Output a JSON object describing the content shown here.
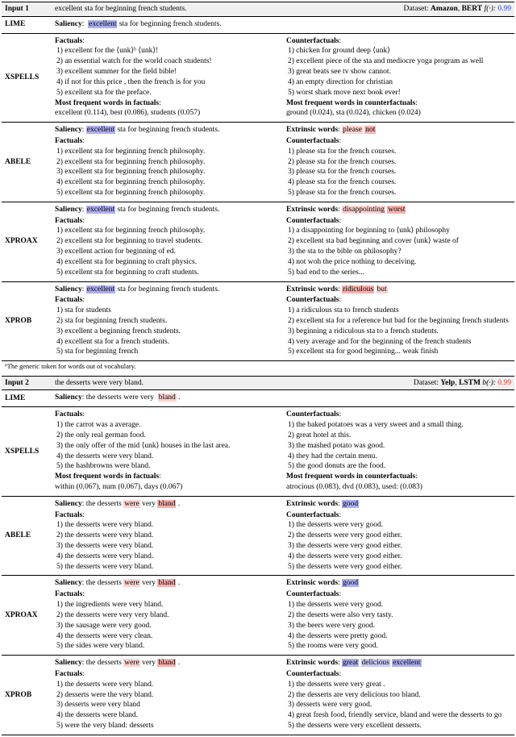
{
  "input1": {
    "label": "Input 1",
    "text": "excellent sta for beginning french students.",
    "dataset_label": "Dataset:",
    "dataset": "Amazon",
    "model": "BERT",
    "fn": "f(·):",
    "score": "0.99"
  },
  "input2": {
    "label": "Input 2",
    "text": "the desserts were very bland.",
    "dataset_label": "Dataset:",
    "dataset": "Yelp",
    "model": "LSTM",
    "fn": "b(·):",
    "score": "0.99"
  },
  "labels": {
    "saliency": "Saliency",
    "factuals": "Factuals",
    "counterfactuals": "Counterfactuals",
    "extrinsic": "Extrinsic words",
    "mffact": "Most frequent words in factuals",
    "mfcf": "Most frequent words in counterfactuals"
  },
  "methods1": {
    "lime": {
      "name": "LIME",
      "sal_pre": "",
      "sal_hl": "excellent",
      "sal_post": " sta for beginning french students."
    },
    "xspells": {
      "name": "XSPELLS",
      "fact": [
        "1) excellent for the ⟨unk⟩ᵇ ⟨unk⟩!",
        "2) an essential watch for the world coach students!",
        "3) excellent summer for the field bible!",
        "4) if not for this price , then the french is for you",
        "5) excellent sta for the preface."
      ],
      "cf": [
        "1) chicken for ground deep ⟨unk⟩",
        "2) excellent piece of the sta and mediocre yoga program as well",
        "3) great beats see tv show cannot.",
        "4) an empty direction for christian",
        "5) worst shark move next book ever!"
      ],
      "mffact": "excellent (0.114), best (0.086), students (0.057)",
      "mfcf": "ground (0.024), sta (0.024), chicken (0.024)"
    },
    "abele": {
      "name": "ABELE",
      "sal_pre": "",
      "sal_hl": "excellent",
      "sal_post": " sta for beginning french students.",
      "ext": [
        {
          "w": "please",
          "c": "hl-red2"
        },
        {
          "w": "not",
          "c": "hl-red"
        }
      ],
      "fact": [
        "1) excellent sta for beginning french philosophy.",
        "2) excellent sta for beginning french philosophy.",
        "3) excellent sta for beginning french philosophy.",
        "4) excellent sta for beginning french philosophy.",
        "5) excellent sta for beginning french philosophy."
      ],
      "cf": [
        "1) please sta for the french courses.",
        "2) please sta for the french courses.",
        "3) please sta for the french courses.",
        "4) please sta for the french courses.",
        "5) please sta for the french courses."
      ]
    },
    "xproax": {
      "name": "XPROAX",
      "sal_pre": "",
      "sal_hl": "excellent",
      "sal_post": " sta for beginning french students.",
      "ext": [
        {
          "w": "disappointing",
          "c": "hl-red2"
        },
        {
          "w": "worst",
          "c": "hl-red"
        }
      ],
      "fact": [
        "1) excellent sta for beginning french philosophy.",
        "2) excellent sta for beginning to travel students.",
        "3) excellent action for beginning of ed.",
        "4) excellent sta for beginning to craft physics.",
        "5) excellent sta for beginning to craft students."
      ],
      "cf": [
        "1) a disappointing for beginning to ⟨unk⟩ philosophy",
        "2) excellent sta bad beginning and cover ⟨unk⟩ waste of",
        "3) the sta to the bible on philosophy?",
        "4) not woh the price nothing to deceiving.",
        "5) bad end to the series..."
      ]
    },
    "xprob": {
      "name": "XPROB",
      "sal_pre": "",
      "sal_hl": "excellent",
      "sal_post": " sta for beginning french students.",
      "ext": [
        {
          "w": "ridiculous",
          "c": "hl-red"
        },
        {
          "w": "but",
          "c": "hl-red2"
        }
      ],
      "fact": [
        "1) sta for students",
        "2) sta for beginning french students.",
        "3) excellent a beginning french students.",
        "4) excellent sta for a french students.",
        "5) sta for beginning french"
      ],
      "cf": [
        "1) a ridiculous sta to french students",
        "2) excellent sta for a reference but bad for the beginning french students",
        "3) beginning a ridiculous sta to a french students.",
        "4) very average and for the beginning of the french students",
        "5) excellent sta for good beginning... weak finish"
      ]
    }
  },
  "methods2": {
    "lime": {
      "name": "LIME",
      "sal_plain": "the desserts were very",
      "sal_hl": "bland",
      "sal_post": " ."
    },
    "xspells": {
      "name": "XSPELLS",
      "fact": [
        "1) the carrot was a average.",
        "2) the only real german food.",
        "3) the only offer of the mid ⟨unk⟩ houses in the last area.",
        "4) the desserts were very bland.",
        "5) the hashbrowns were bland."
      ],
      "cf": [
        "1) the baked potatoes was a very sweet and a small thing.",
        "2) great hotel at this.",
        "3) the mashed potato was good.",
        "4) they had the certain menu.",
        "5) the good donuts are the food."
      ],
      "mffact": "within (0.067), num (0.067), days (0.067)",
      "mfcf": "atrocious (0.083), dvd (0.083), used: (0.083)"
    },
    "abele": {
      "name": "ABELE",
      "sal_tokens": [
        {
          "t": "the desserts",
          "c": ""
        },
        {
          "t": "were",
          "c": "hl-red2"
        },
        {
          "t": "very",
          "c": ""
        },
        {
          "t": "bland",
          "c": "hl-red"
        },
        {
          "t": ".",
          "c": ""
        }
      ],
      "ext": [
        {
          "w": "good",
          "c": "hl-blue"
        }
      ],
      "fact": [
        "1) the desserts were very bland.",
        "2) the desserts were very bland.",
        "3) the desserts were very bland.",
        "4) the desserts were very bland.",
        "5) the desserts were very bland."
      ],
      "cf": [
        "1) the desserts were very good.",
        "2) the desserts were very good either.",
        "3) the desserts were very good either.",
        "4) the desserts were very good either.",
        "5) the desserts were very good either."
      ]
    },
    "xproax": {
      "name": "XPROAX",
      "sal_tokens": [
        {
          "t": "the desserts",
          "c": ""
        },
        {
          "t": "were",
          "c": "hl-red2"
        },
        {
          "t": "very",
          "c": ""
        },
        {
          "t": "bland",
          "c": "hl-red"
        },
        {
          "t": ".",
          "c": ""
        }
      ],
      "ext": [
        {
          "w": "good",
          "c": "hl-blue"
        }
      ],
      "fact": [
        "1) the ingredients were very bland.",
        "2) the desserts were very very bland.",
        "3) the sausage were very good.",
        "4) the desserts were very clean.",
        "5) the sides were very bland."
      ],
      "cf": [
        "1) the desserts were very good.",
        "2) the deserts were also very tasty.",
        "3) the beers were very good.",
        "4) the desserts were pretty good.",
        "5) the rooms were very good."
      ]
    },
    "xprob": {
      "name": "XPROB",
      "sal_tokens": [
        {
          "t": "the desserts",
          "c": ""
        },
        {
          "t": "were",
          "c": "hl-red2"
        },
        {
          "t": "very",
          "c": ""
        },
        {
          "t": "bland",
          "c": "hl-red"
        },
        {
          "t": ".",
          "c": ""
        }
      ],
      "ext": [
        {
          "w": "great",
          "c": "hl-blue"
        },
        {
          "w": "delicious",
          "c": "hl-blue2"
        },
        {
          "w": "excellent",
          "c": "hl-blue"
        }
      ],
      "fact": [
        "1) the desserts were very bland.",
        "2) desserts were the very bland.",
        "3) desserts were very bland",
        "4) the desserts were bland.",
        "5) were the very bland: desserts"
      ],
      "cf": [
        "1) the desserts were very great .",
        "2) the desserts are very delicious too bland.",
        "3) desserts were very good.",
        "4) great fresh food, friendly service, bland and were the desserts to go",
        "5) the desserts were very excellent desserts."
      ]
    }
  },
  "footnote": "ᵇThe generic token for words out of vocabulary."
}
